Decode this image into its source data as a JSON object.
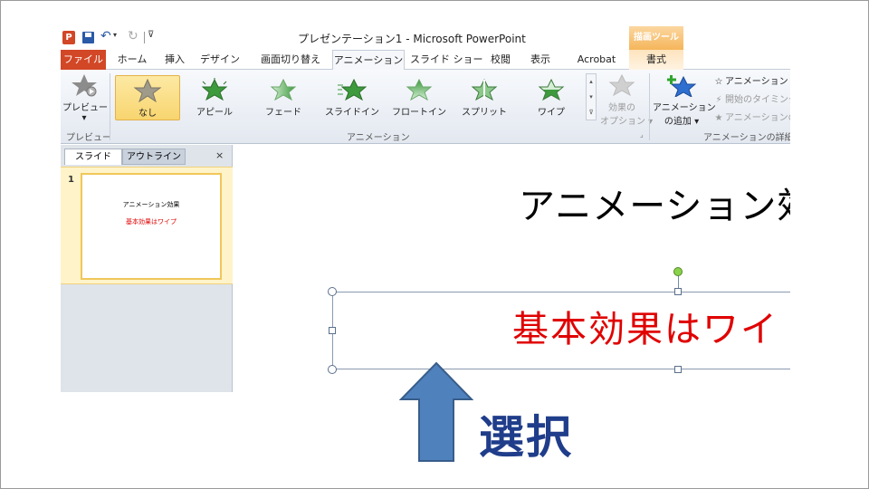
{
  "window": {
    "title": "プレゼンテーション1 - Microsoft PowerPoint",
    "app_logo": "P",
    "context_tab_header": "描画ツール"
  },
  "tabs": [
    {
      "label": "ファイル"
    },
    {
      "label": "ホーム"
    },
    {
      "label": "挿入"
    },
    {
      "label": "デザイン"
    },
    {
      "label": "画面切り替え"
    },
    {
      "label": "アニメーション"
    },
    {
      "label": "スライド ショー"
    },
    {
      "label": "校閲"
    },
    {
      "label": "表示"
    },
    {
      "label": "Acrobat"
    },
    {
      "label": "書式"
    }
  ],
  "ribbon": {
    "preview": {
      "label": "プレビュー",
      "group_label": "プレビュー"
    },
    "effects": [
      {
        "label": "なし",
        "icon": "star-none-icon"
      },
      {
        "label": "アピール",
        "icon": "star-appear-icon"
      },
      {
        "label": "フェード",
        "icon": "star-fade-icon"
      },
      {
        "label": "スライドイン",
        "icon": "star-fly-in-icon"
      },
      {
        "label": "フロートイン",
        "icon": "star-float-in-icon"
      },
      {
        "label": "スプリット",
        "icon": "star-split-icon"
      },
      {
        "label": "ワイプ",
        "icon": "star-wipe-icon"
      }
    ],
    "animation_group_label": "アニメーション",
    "effect_options": {
      "line1": "効果の",
      "line2": "オプション ▾"
    },
    "add_animation": {
      "line1": "アニメーション",
      "line2": "の追加 ▾"
    },
    "advanced_items": [
      {
        "label": "アニメーション ウ"
      },
      {
        "label": "開始のタイミング"
      },
      {
        "label": "アニメーションの"
      }
    ],
    "advanced_group_label": "アニメーションの詳細設"
  },
  "panel": {
    "tab_slides": "スライド",
    "tab_outline": "アウトライン",
    "close": "×",
    "slide_number": "1",
    "thumb_title": "アニメーション効果",
    "thumb_body": "基本効果はワイプ"
  },
  "slide": {
    "title": "アニメーション效",
    "body": "基本効果はワイ"
  },
  "annotation": {
    "label": "選択"
  },
  "colors": {
    "accent_file_tab": "#d24726",
    "body_text": "#e00000",
    "annotation": "#1f3d8a",
    "arrow_fill": "#4f81bd",
    "selected_effect": "#f8d56f"
  }
}
